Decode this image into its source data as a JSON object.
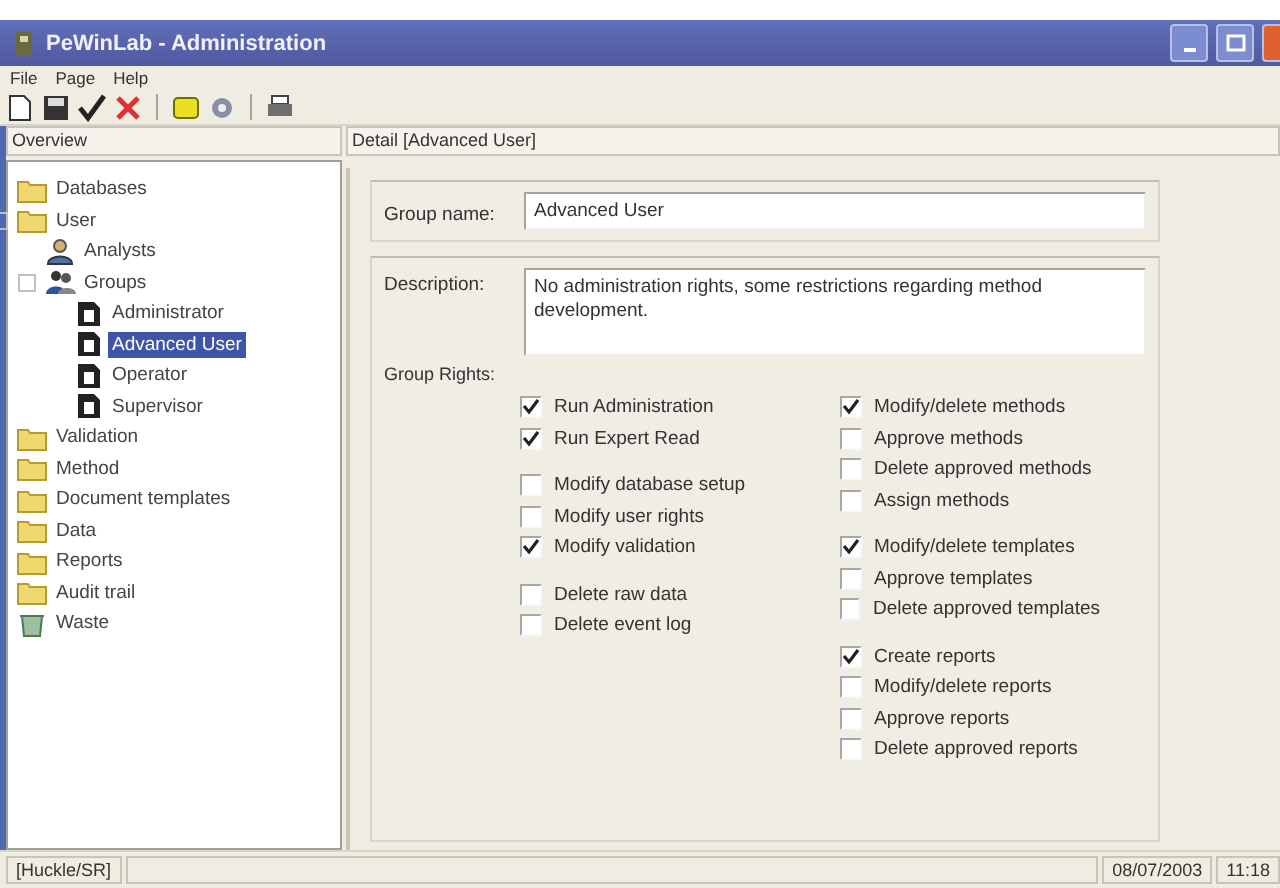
{
  "window": {
    "title": "PeWinLab - Administration"
  },
  "menu": [
    "File",
    "Page",
    "Help"
  ],
  "toolbar": [
    {
      "kind": "new"
    },
    {
      "kind": "save"
    },
    {
      "kind": "check"
    },
    {
      "kind": "delete"
    },
    {
      "kind": "sep"
    },
    {
      "kind": "box"
    },
    {
      "kind": "gear"
    },
    {
      "kind": "sep"
    },
    {
      "kind": "print"
    }
  ],
  "overview": {
    "title": "Overview",
    "items": [
      {
        "label": "Databases",
        "kind": "folder",
        "selected": false
      },
      {
        "label": "User",
        "kind": "folder",
        "selected": false,
        "children": [
          {
            "label": "Analysts",
            "kind": "user",
            "selected": false
          },
          {
            "label": "Groups",
            "kind": "group",
            "selected": false,
            "children": [
              {
                "label": "Administrator",
                "kind": "doc",
                "selected": false
              },
              {
                "label": "Advanced User",
                "kind": "doc",
                "selected": true
              },
              {
                "label": "Operator",
                "kind": "doc",
                "selected": false
              },
              {
                "label": "Supervisor",
                "kind": "doc",
                "selected": false
              }
            ]
          }
        ]
      },
      {
        "label": "Validation",
        "kind": "folder",
        "selected": false
      },
      {
        "label": "Method",
        "kind": "folder",
        "selected": false
      },
      {
        "label": "Document templates",
        "kind": "folder",
        "selected": false
      },
      {
        "label": "Data",
        "kind": "folder",
        "selected": false
      },
      {
        "label": "Reports",
        "kind": "folder",
        "selected": false
      },
      {
        "label": "Audit trail",
        "kind": "folder",
        "selected": false
      },
      {
        "label": "Waste",
        "kind": "waste",
        "selected": false
      }
    ]
  },
  "detail": {
    "title": "Detail [Advanced User]",
    "group_name_label": "Group name:",
    "group_name": "Advanced User",
    "description_label": "Description:",
    "description": "No administration rights, some restrictions regarding method development.",
    "rights_label": "Group Rights:",
    "rights": [
      [
        [
          {
            "label": "Run Administration",
            "checked": true
          },
          {
            "label": "Run Expert Read",
            "checked": true
          }
        ],
        [
          {
            "label": "Modify database setup",
            "checked": false
          },
          {
            "label": "Modify user rights",
            "checked": false
          },
          {
            "label": "Modify validation",
            "checked": true
          }
        ],
        [
          {
            "label": "Delete raw data",
            "checked": false
          },
          {
            "label": "Delete event log",
            "checked": false
          }
        ]
      ],
      [
        [
          {
            "label": "Modify/delete methods",
            "checked": true
          },
          {
            "label": "Approve methods",
            "checked": false
          },
          {
            "label": "Delete approved methods",
            "checked": false
          },
          {
            "label": "Assign methods",
            "checked": false
          }
        ],
        [
          {
            "label": "Modify/delete templates",
            "checked": true
          },
          {
            "label": "Approve templates",
            "checked": false
          },
          {
            "label": "Delete approved templates",
            "checked": false
          }
        ],
        [
          {
            "label": "Create reports",
            "checked": true
          },
          {
            "label": "Modify/delete reports",
            "checked": false
          },
          {
            "label": "Approve reports",
            "checked": false
          },
          {
            "label": "Delete approved reports",
            "checked": false
          }
        ]
      ]
    ]
  },
  "status_bar": {
    "user": "[Huckle/SR]",
    "date": "08/07/2003",
    "time": "11:18"
  }
}
